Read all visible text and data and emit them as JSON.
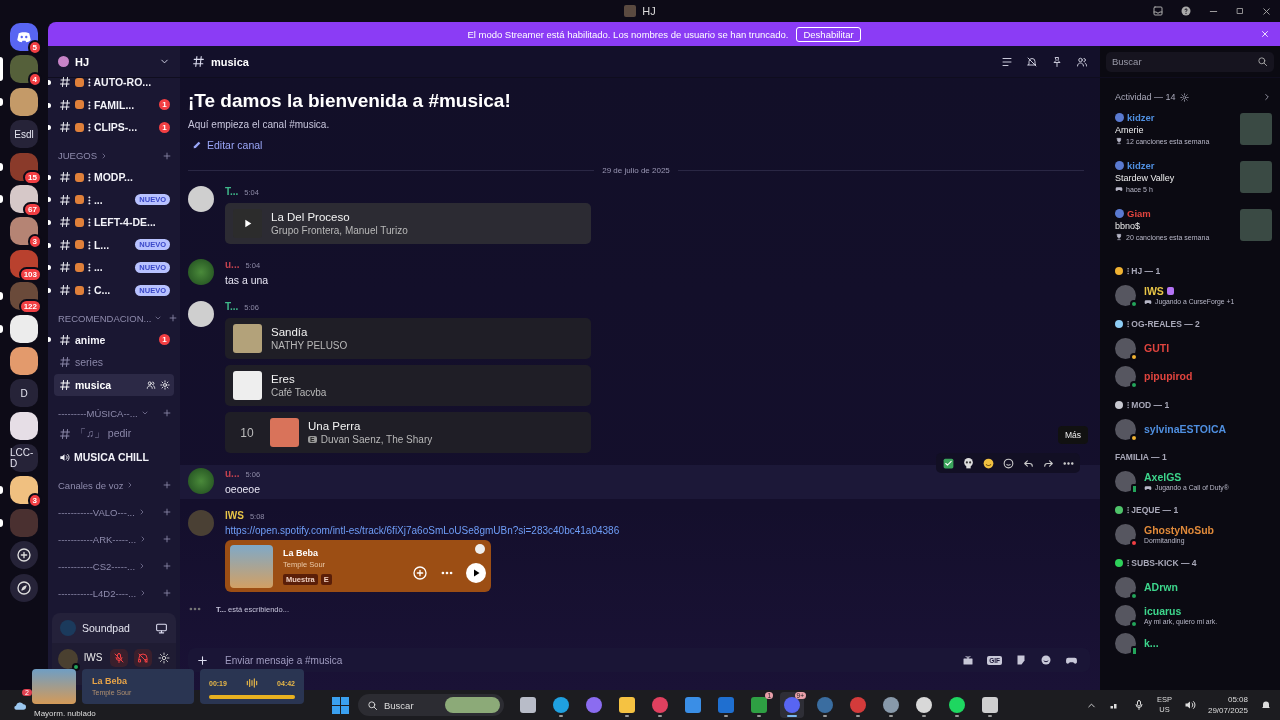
{
  "window": {
    "title": "HJ"
  },
  "banner": {
    "text": "El modo Streamer está habilitado. Los nombres de usuario se han truncado.",
    "button": "Deshabilitar"
  },
  "servers": [
    {
      "kind": "home",
      "badge": "5",
      "unread": false,
      "selected": false
    },
    {
      "kind": "avatar",
      "color": "#55603a",
      "badge": "4",
      "unread": false,
      "selected": true
    },
    {
      "kind": "avatar",
      "color": "#c49a68",
      "unread": true,
      "selected": false
    },
    {
      "kind": "text",
      "label": "Esdl",
      "unread": false,
      "selected": false
    },
    {
      "kind": "avatar",
      "color": "#8a3a2a",
      "badge": "15",
      "unread": true,
      "selected": false
    },
    {
      "kind": "avatar",
      "color": "#d6c8c8",
      "badge": "67",
      "unread": true,
      "selected": false
    },
    {
      "kind": "avatar",
      "color": "#b58474",
      "badge": "3",
      "unread": false,
      "selected": false
    },
    {
      "kind": "avatar",
      "color": "#b9412e",
      "badge": "103",
      "unread": false,
      "selected": false
    },
    {
      "kind": "avatar",
      "color": "#6a4a3a",
      "badge": "122",
      "unread": true,
      "selected": false
    },
    {
      "kind": "avatar",
      "color": "#ececec",
      "unread": true,
      "selected": false
    },
    {
      "kind": "avatar",
      "color": "#e39a6c",
      "unread": false,
      "selected": false
    },
    {
      "kind": "text",
      "label": "D",
      "unread": false,
      "selected": false
    },
    {
      "kind": "avatar",
      "color": "#e6dee6",
      "unread": false,
      "selected": false
    },
    {
      "kind": "text",
      "label": "LCC-D",
      "unread": false,
      "selected": false
    },
    {
      "kind": "avatar",
      "color": "#f0c080",
      "badge": "3",
      "unread": true,
      "selected": false
    },
    {
      "kind": "avatar",
      "color": "#4a3030",
      "unread": true,
      "selected": false
    },
    {
      "kind": "add",
      "unread": false,
      "selected": false
    },
    {
      "kind": "explore",
      "unread": false,
      "selected": false
    }
  ],
  "guild": {
    "name": "HJ"
  },
  "channels": [
    {
      "kind": "text",
      "name": "⁝ AUTO-RO...",
      "emoji": true,
      "unread": true,
      "selected": false
    },
    {
      "kind": "text",
      "name": "⁝ FAMIL...",
      "emoji": true,
      "unread": true,
      "selected": false,
      "badge": "1"
    },
    {
      "kind": "text",
      "name": "⁝ CLIPS-...",
      "emoji": true,
      "unread": true,
      "selected": false,
      "badge": "1"
    },
    {
      "kind": "category",
      "name": "JUEGOS",
      "expanded": false
    },
    {
      "kind": "text",
      "name": "⁝ MODP...",
      "emoji": true,
      "unread": true,
      "selected": false
    },
    {
      "kind": "text",
      "name": "⁝ ...",
      "emoji": true,
      "unread": true,
      "selected": false,
      "tag": "NUEVO"
    },
    {
      "kind": "text",
      "name": "⁝ LEFT-4-DE...",
      "emoji": true,
      "unread": true,
      "selected": false
    },
    {
      "kind": "text",
      "name": "⁝ L...",
      "emoji": true,
      "unread": true,
      "selected": false,
      "tag": "NUEVO"
    },
    {
      "kind": "text",
      "name": "⁝ ...",
      "emoji": true,
      "unread": true,
      "selected": false,
      "tag": "NUEVO"
    },
    {
      "kind": "text",
      "name": "⁝ C...",
      "emoji": true,
      "unread": true,
      "selected": false,
      "tag": "NUEVO"
    },
    {
      "kind": "category",
      "name": "RECOMENDACION...",
      "expanded": true
    },
    {
      "kind": "text",
      "name": "anime",
      "emoji": false,
      "unread": true,
      "selected": false,
      "badge": "1"
    },
    {
      "kind": "text",
      "name": "series",
      "emoji": false,
      "unread": false,
      "selected": false
    },
    {
      "kind": "text",
      "name": "musica",
      "emoji": false,
      "unread": false,
      "selected": true
    },
    {
      "kind": "category",
      "name": "---------MÚSICA--...",
      "expanded": true
    },
    {
      "kind": "text",
      "name": "「♫」 pedir",
      "emoji": false,
      "unread": false,
      "selected": false
    },
    {
      "kind": "voice",
      "name": "MUSICA CHILL"
    },
    {
      "kind": "category",
      "name": "Canales de voz",
      "expanded": false
    },
    {
      "kind": "category",
      "name": "-----------VALO---...",
      "expanded": false
    },
    {
      "kind": "category",
      "name": "-----------ARK-----...",
      "expanded": false
    },
    {
      "kind": "category",
      "name": "-----------CS2-----...",
      "expanded": false
    },
    {
      "kind": "category",
      "name": "-----------L4D2----...",
      "expanded": false
    }
  ],
  "activity_panel": {
    "name": "Soundpad"
  },
  "user_panel": {
    "name": "lWS",
    "mic_muted": true,
    "deafened": true
  },
  "now_playing": {
    "title": "La Beba",
    "artist": "Temple Sour",
    "elapsed": "00:19",
    "duration": "04:42",
    "level": 1
  },
  "chat": {
    "channel": "musica",
    "search": {
      "placeholder": "Buscar"
    },
    "welcome_title": "¡Te damos la bienvenida a #musica!",
    "welcome_text": "Aquí empieza el canal #musica.",
    "edit_link": "Editar canal",
    "date": "29 de julio de 2025",
    "messages": [
      {
        "author": "T...",
        "color": "#3fb98a",
        "time": "5:04",
        "hovered": false,
        "tracks": [
          {
            "kind": "playable",
            "title": "La Del Proceso",
            "artist": "Grupo Frontera, Manuel Turizo",
            "color": "#2c2c2c"
          }
        ]
      },
      {
        "author": "u...",
        "color": "#c2414e",
        "time": "5:04",
        "hovered": false,
        "text": "tas a una"
      },
      {
        "author": "T...",
        "color": "#3fb98a",
        "time": "5:06",
        "hovered": false,
        "tracks": [
          {
            "kind": "plain",
            "title": "Sandía",
            "artist": "NATHY PELUSO",
            "color": "#b3a27a"
          },
          {
            "kind": "plain",
            "title": "Eres",
            "artist": "Café Tacvba",
            "color": "#eeeeee"
          },
          {
            "kind": "numbered",
            "number": "10",
            "title": "Una Perra",
            "badge": "E",
            "artist": "Duvan Saenz, The Shary",
            "color": "#d9735a"
          }
        ]
      },
      {
        "author": "u...",
        "color": "#c2414e",
        "time": "5:06",
        "hovered": true,
        "tooltip": "Más",
        "text": "oeoeoe"
      },
      {
        "author": "lWS",
        "color": "#e8c547",
        "time": "5:08",
        "hovered": false,
        "link": "https://open.spotify.com/intl-es/track/6fiXj7a6oSmLoUSe8gmUBn?si=283c40bc41a04386",
        "embed": {
          "title": "La Beba",
          "artist": "Temple Sour",
          "tags": [
            "Muestra",
            "E"
          ]
        }
      }
    ],
    "typing": "**T...** está escribiendo...",
    "input": {
      "placeholder": "Enviar mensaje a #musica",
      "gif": "GIF"
    }
  },
  "members": {
    "activity_title": "Actividad — 14",
    "activities": [
      {
        "user": "kidzer",
        "color": "#4f8fe0",
        "title": "Amerie",
        "detail": "12 canciones esta semana",
        "kind": "music"
      },
      {
        "user": "kidzer",
        "color": "#4f8fe0",
        "title": "Stardew Valley",
        "detail": "hace 5 h",
        "kind": "game"
      },
      {
        "user": "Giam",
        "color": "#e0443e",
        "title": "bbno$",
        "detail": "20 canciones esta semana",
        "kind": "music"
      }
    ],
    "groups": [
      {
        "name": "⁝ HJ — 1",
        "color": "#f0b232",
        "members": [
          {
            "name": "lWS",
            "color": "#e8c547",
            "kind": "online",
            "boost": true,
            "status": {
              "kind": "game",
              "text": "Jugando a CurseForge +1"
            }
          }
        ]
      },
      {
        "name": "⁝ OG-REALES — 2",
        "color": "#8ecdf5",
        "members": [
          {
            "name": "GUTI",
            "color": "#e0443e",
            "kind": "idle",
            "boost": false
          },
          {
            "name": "pipupirod",
            "color": "#e0443e",
            "kind": "online",
            "boost": false
          }
        ]
      },
      {
        "name": "⁝ MOD — 1",
        "color": "#c8c8d0",
        "members": [
          {
            "name": "sylvinaESTOICA",
            "color": "#4f8fe0",
            "kind": "idle",
            "boost": false
          }
        ]
      },
      {
        "name": "FAMILIA — 1",
        "members": [
          {
            "name": "AxelGS",
            "color": "#3dd68c",
            "kind": "mobile",
            "boost": false,
            "status": {
              "kind": "game",
              "text": "Jugando a Call of Duty®"
            }
          }
        ]
      },
      {
        "name": "⁝ JEQUE — 1",
        "color": "#4fc36a",
        "members": [
          {
            "name": "GhostyNoSub",
            "color": "#e08a3a",
            "kind": "dnd",
            "boost": false,
            "status": {
              "kind": "custom",
              "text": "Dormitanding"
            }
          }
        ]
      },
      {
        "name": "⁝ SUBS-KICK — 4",
        "color": "#2ed15a",
        "members": [
          {
            "name": "ADrwn",
            "color": "#3dd68c",
            "kind": "online",
            "boost": false
          },
          {
            "name": "icuarus",
            "color": "#3dd68c",
            "kind": "online",
            "boost": false,
            "status": {
              "kind": "custom",
              "text": "Ay mi ark, quiero mi ark."
            }
          },
          {
            "name": "k...",
            "color": "#3dd68c",
            "kind": "mobile",
            "boost": false
          }
        ]
      }
    ]
  },
  "taskbar": {
    "weather": {
      "badge": "2",
      "text": "Mayorm. nublado"
    },
    "search": "Buscar",
    "apps": [
      {
        "kind": "square",
        "color": "#b8bcc8",
        "running": false,
        "active": false
      },
      {
        "kind": "circle",
        "color": "#1fa0e0",
        "running": true,
        "active": false
      },
      {
        "kind": "circle",
        "color": "#8b6cf0",
        "running": false,
        "active": false
      },
      {
        "kind": "square",
        "color": "#f5c242",
        "running": true,
        "active": false
      },
      {
        "kind": "circle",
        "color": "#e0405f",
        "running": true,
        "active": false
      },
      {
        "kind": "square",
        "color": "#3a8ee6",
        "running": false,
        "active": false
      },
      {
        "kind": "square",
        "color": "#1f6fd0",
        "running": true,
        "active": false
      },
      {
        "kind": "square",
        "color": "#2ea043",
        "running": true,
        "active": false,
        "badge": "1"
      },
      {
        "kind": "circle",
        "color": "#5865f2",
        "running": true,
        "active": true,
        "badge": "9+"
      },
      {
        "kind": "circle",
        "color": "#3a6da0",
        "running": true,
        "active": false
      },
      {
        "kind": "circle",
        "color": "#d33b3b",
        "running": true,
        "active": false
      },
      {
        "kind": "circle",
        "color": "#8899aa",
        "running": true,
        "active": false
      },
      {
        "kind": "circle",
        "color": "#d8d8d8",
        "running": true,
        "active": false
      },
      {
        "kind": "circle",
        "color": "#1ed760",
        "running": true,
        "active": false
      },
      {
        "kind": "square",
        "color": "#cfcfcf",
        "running": true,
        "active": false
      }
    ],
    "lang": "ESP",
    "layout": "US",
    "time": "05:08",
    "date": "29/07/2025"
  }
}
